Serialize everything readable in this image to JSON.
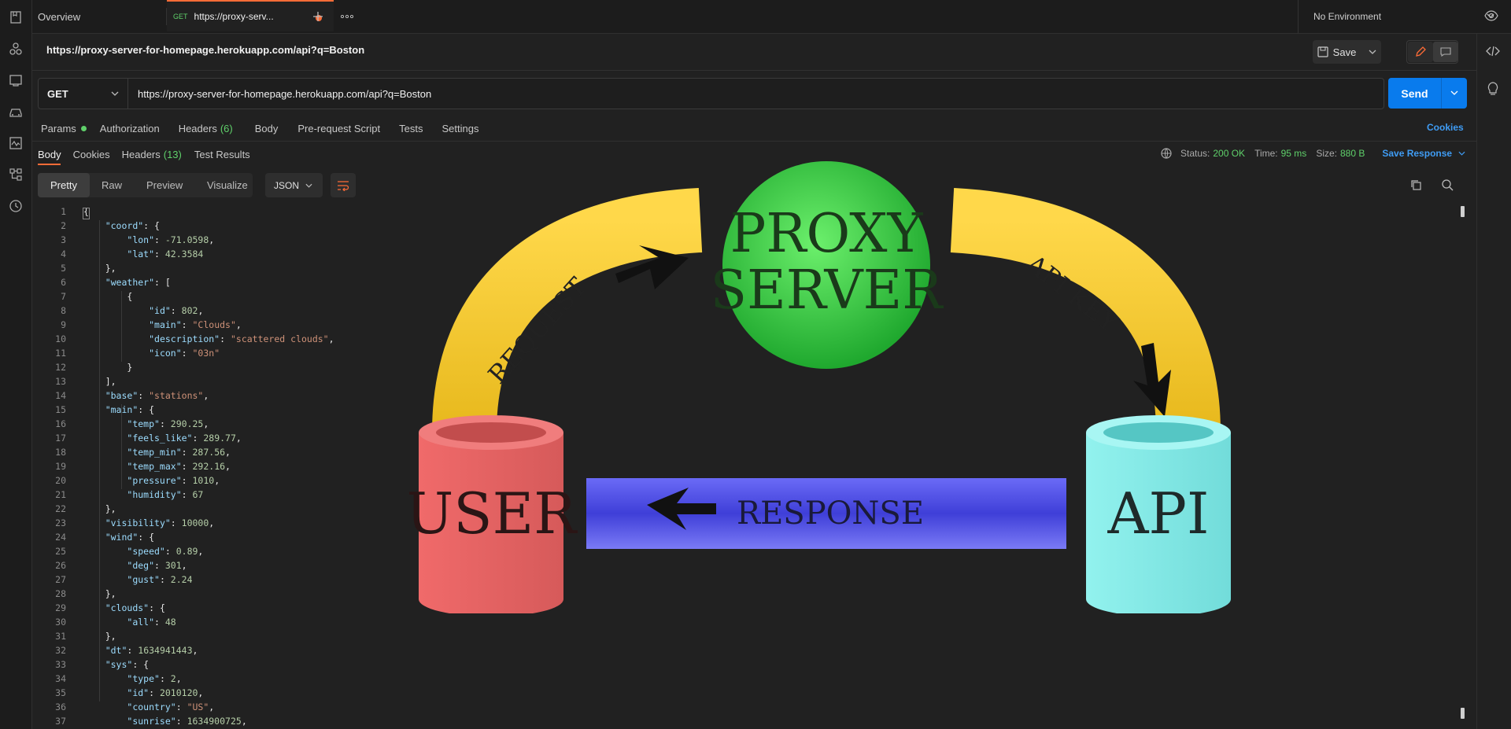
{
  "tabs": {
    "overview": "Overview",
    "active_method": "GET",
    "active_label": "https://proxy-serv...",
    "environment": "No Environment"
  },
  "request": {
    "title": "https://proxy-server-for-homepage.herokuapp.com/api?q=Boston",
    "save_label": "Save",
    "method": "GET",
    "url": "https://proxy-server-for-homepage.herokuapp.com/api?q=Boston",
    "send_label": "Send"
  },
  "request_tabs": [
    "Params",
    "Authorization",
    "Headers",
    "Body",
    "Pre-request Script",
    "Tests",
    "Settings"
  ],
  "headers_count": "(6)",
  "cookies_link": "Cookies",
  "response_tabs": {
    "body": "Body",
    "cookies": "Cookies",
    "headers": "Headers",
    "headers_count": "(13)",
    "test_results": "Test Results"
  },
  "status": {
    "status_label": "Status:",
    "status_value": "200 OK",
    "time_label": "Time:",
    "time_value": "95 ms",
    "size_label": "Size:",
    "size_value": "880 B",
    "save_response": "Save Response"
  },
  "view_modes": [
    "Pretty",
    "Raw",
    "Preview",
    "Visualize"
  ],
  "format": "JSON",
  "diagram": {
    "proxy_line1": "PROXY",
    "proxy_line2": "SERVER",
    "user": "USER",
    "api": "API",
    "request": "REQUEST",
    "api_key": "API KEY",
    "response": "RESPONSE"
  },
  "code_lines": [
    "{",
    "    \"coord\": {",
    "        \"lon\": -71.0598,",
    "        \"lat\": 42.3584",
    "    },",
    "    \"weather\": [",
    "        {",
    "            \"id\": 802,",
    "            \"main\": \"Clouds\",",
    "            \"description\": \"scattered clouds\",",
    "            \"icon\": \"03n\"",
    "        }",
    "    ],",
    "    \"base\": \"stations\",",
    "    \"main\": {",
    "        \"temp\": 290.25,",
    "        \"feels_like\": 289.77,",
    "        \"temp_min\": 287.56,",
    "        \"temp_max\": 292.16,",
    "        \"pressure\": 1010,",
    "        \"humidity\": 67",
    "    },",
    "    \"visibility\": 10000,",
    "    \"wind\": {",
    "        \"speed\": 0.89,",
    "        \"deg\": 301,",
    "        \"gust\": 2.24",
    "    },",
    "    \"clouds\": {",
    "        \"all\": 48",
    "    },",
    "    \"dt\": 1634941443,",
    "    \"sys\": {",
    "        \"type\": 2,",
    "        \"id\": 2010120,",
    "        \"country\": \"US\",",
    "        \"sunrise\": 1634900725,"
  ]
}
